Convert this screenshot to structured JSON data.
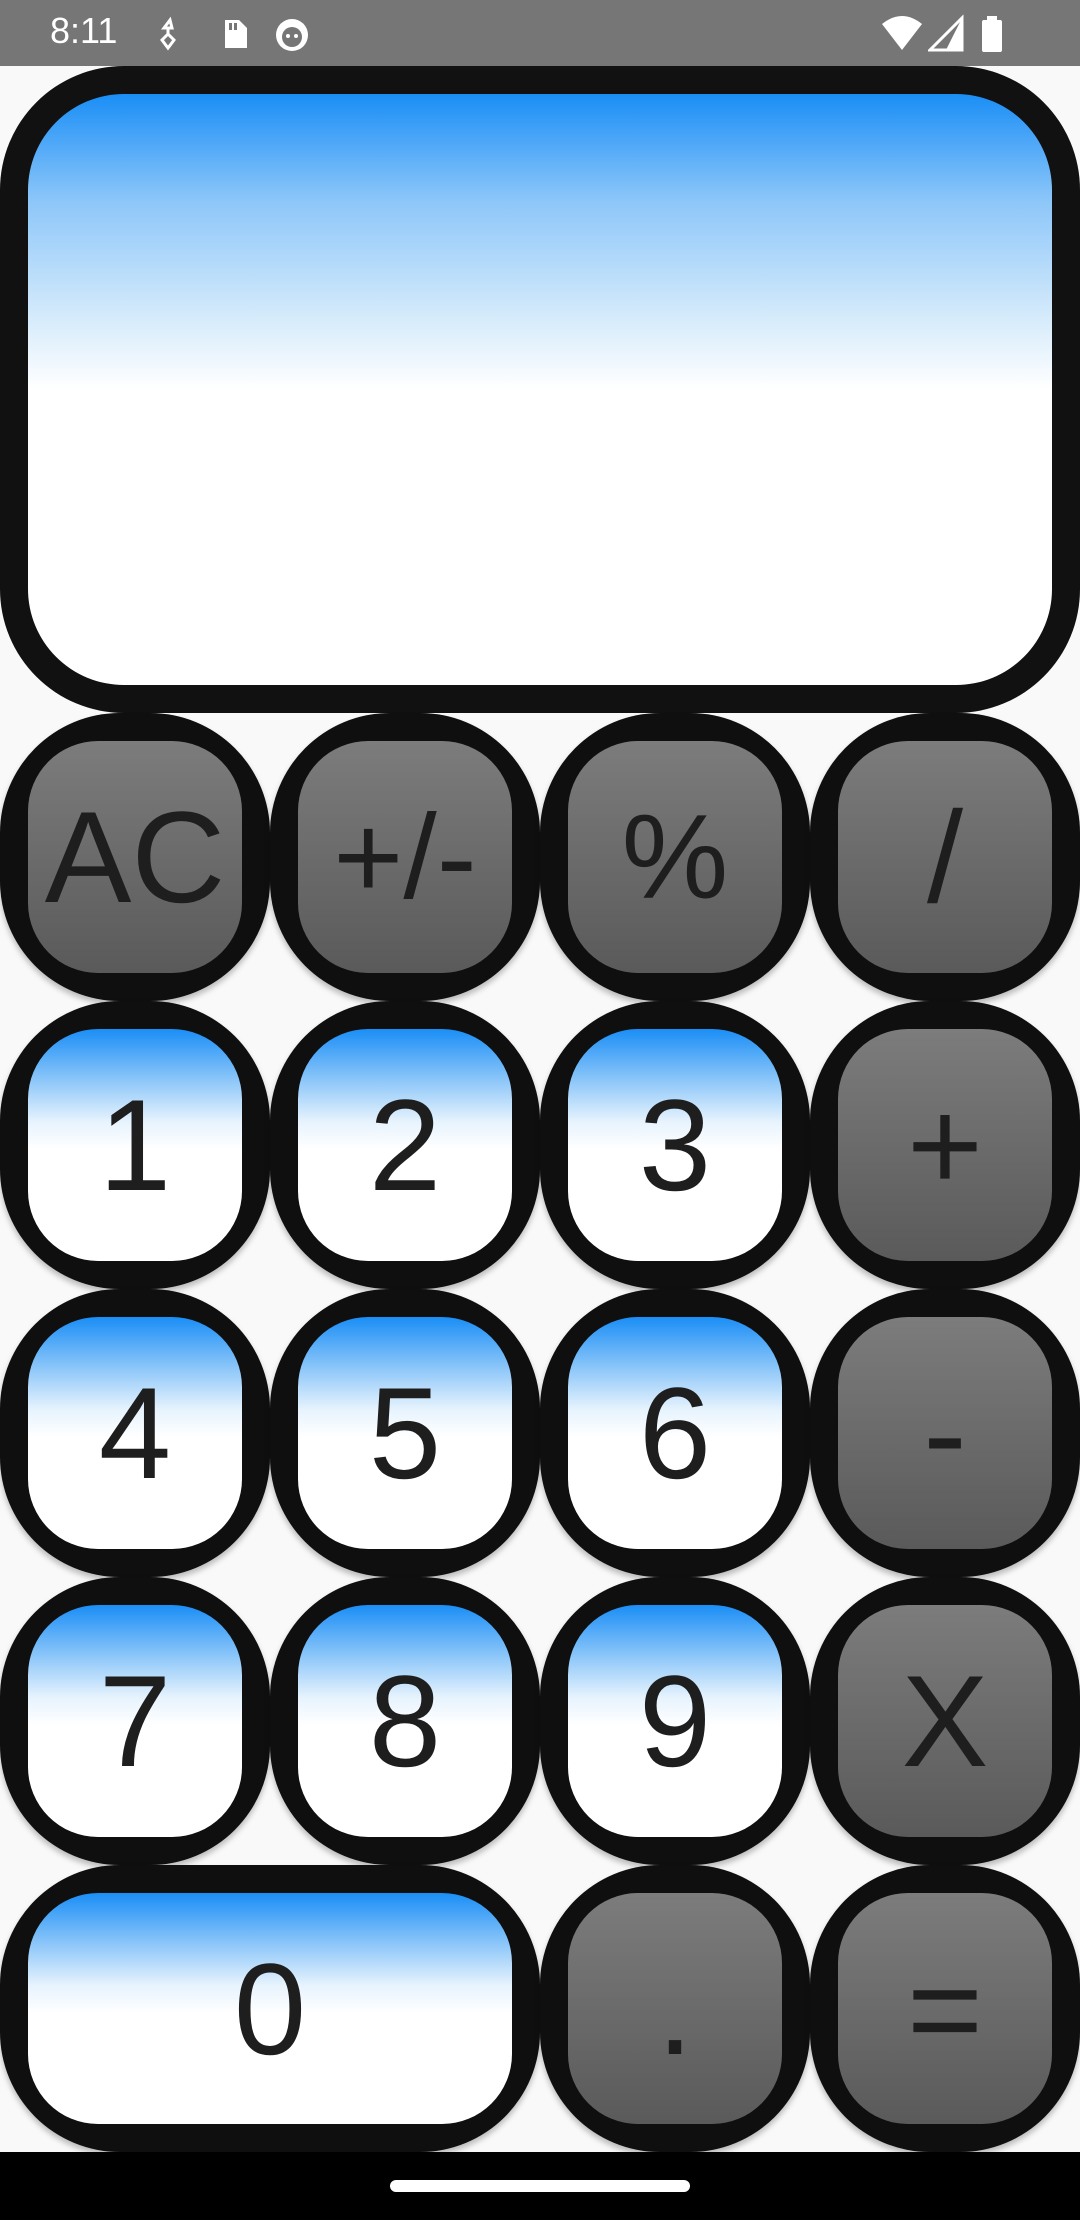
{
  "status_bar": {
    "time": "8:11",
    "icons_left": [
      "usb-debug-icon",
      "sd-card-icon",
      "cat-icon"
    ],
    "icons_right": [
      "wifi-icon",
      "signal-icon",
      "battery-icon"
    ]
  },
  "display": {
    "value": ""
  },
  "keys": {
    "ac": "AC",
    "sign": "+/-",
    "percent": "%",
    "divide": "/",
    "one": "1",
    "two": "2",
    "three": "3",
    "plus": "+",
    "four": "4",
    "five": "5",
    "six": "6",
    "minus": "-",
    "seven": "7",
    "eight": "8",
    "nine": "9",
    "multiply": "X",
    "zero": "0",
    "decimal": ".",
    "equals": "="
  },
  "colors": {
    "accent_blue": "#1a8ef6",
    "key_border": "#0f0f0f",
    "operator_gray": "#6a6a6a",
    "status_bar": "#767676"
  }
}
